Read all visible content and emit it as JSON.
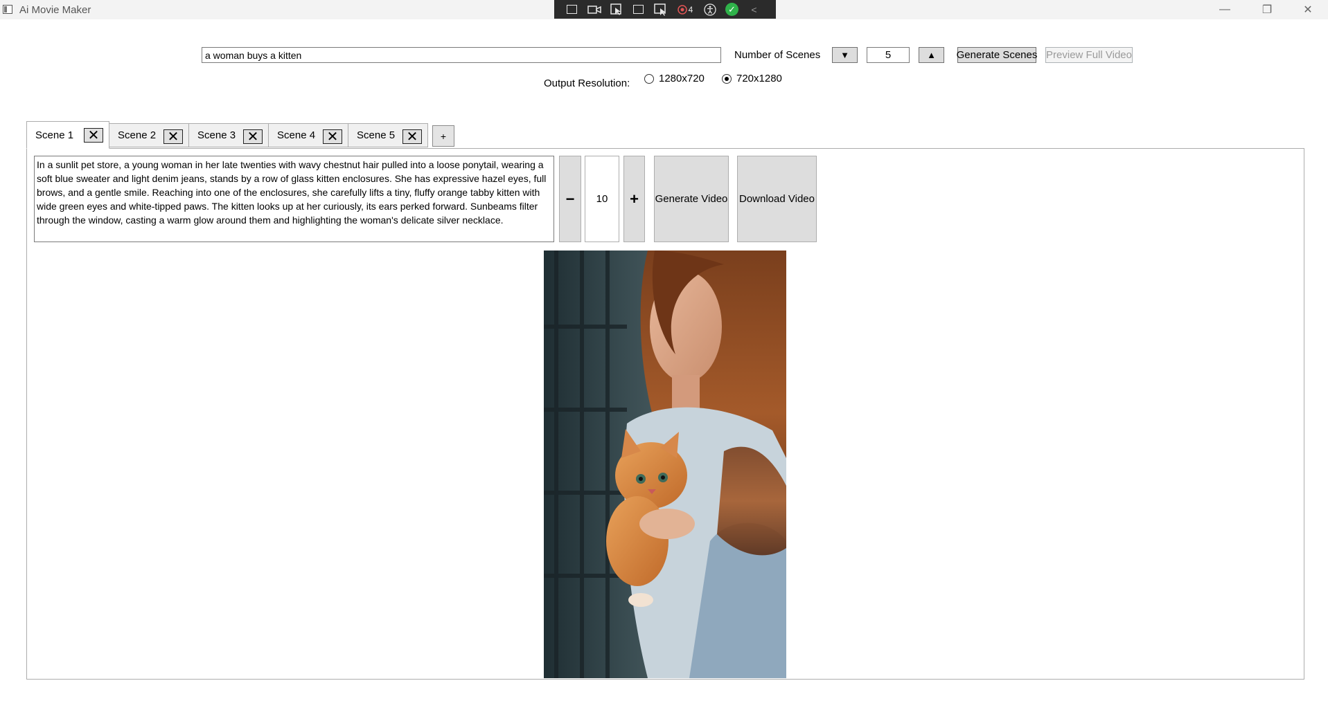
{
  "window": {
    "title": "Ai Movie Maker",
    "minimize_label": "—",
    "restore_label": "❐",
    "close_label": "✕"
  },
  "debug_toolbar": {
    "counter": "4",
    "collapse_label": "<"
  },
  "prompt": {
    "value": "a woman buys a kitten"
  },
  "scenes": {
    "label": "Number of Scenes",
    "decrement_label": "▼",
    "value": "5",
    "increment_label": "▲"
  },
  "buttons": {
    "generate_scenes": "Generate Scenes",
    "preview_full_video": "Preview Full Video"
  },
  "resolution": {
    "label": "Output Resolution:",
    "options": [
      "1280x720",
      "720x1280"
    ],
    "selected": "720x1280"
  },
  "tabs": [
    {
      "label": "Scene 1",
      "active": true
    },
    {
      "label": "Scene 2",
      "active": false
    },
    {
      "label": "Scene 3",
      "active": false
    },
    {
      "label": "Scene 4",
      "active": false
    },
    {
      "label": "Scene 5",
      "active": false
    }
  ],
  "tab_close_label": "✕",
  "add_tab_label": "+",
  "scene": {
    "description": "In a sunlit pet store, a young woman in her late twenties with wavy chestnut hair pulled into a loose ponytail, wearing a soft blue sweater and light denim jeans, stands by a row of glass kitten enclosures. She has expressive hazel eyes, full brows, and a gentle smile. Reaching into one of the enclosures, she carefully lifts a tiny, fluffy orange tabby kitten with wide green eyes and white-tipped paws. The kitten looks up at her curiously, its ears perked forward. Sunbeams filter through the window, casting a warm glow around them and highlighting the woman's delicate silver necklace.",
    "duration_decrement_label": "−",
    "duration": "10",
    "duration_increment_label": "+",
    "generate_video_label": "Generate Video",
    "download_video_label": "Download Video"
  }
}
